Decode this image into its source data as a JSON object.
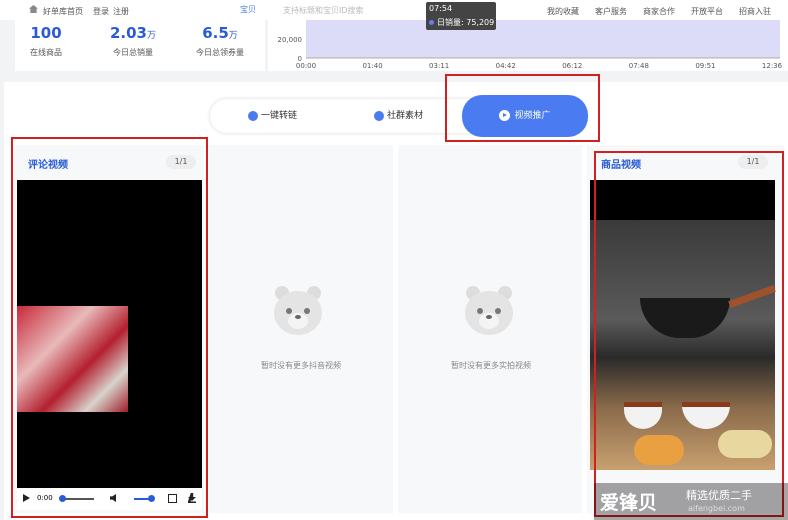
{
  "nav": {
    "home": "好单库首页",
    "login": "登录",
    "register": "注册",
    "search_tab": "宝贝",
    "search_placeholder": "支持标题和宝贝ID搜索",
    "favorites": "我的收藏",
    "service": "客户服务",
    "merchant": "商家合作",
    "open": "开放平台",
    "join": "招商入驻"
  },
  "stats": [
    {
      "value": "100",
      "unit": "",
      "label": "在线商品"
    },
    {
      "value": "2.03",
      "unit": "万",
      "label": "今日总销量"
    },
    {
      "value": "6.5",
      "unit": "万",
      "label": "今日总领券量"
    }
  ],
  "chart_data": {
    "type": "area",
    "x": [
      "00:00",
      "01:40",
      "03:11",
      "04:42",
      "06:12",
      "07:48",
      "09:51",
      "12:36"
    ],
    "yticks": [
      "20,000",
      "0"
    ],
    "tooltip_time": "07:54",
    "tooltip_label": "日销量: 75,209",
    "colors": {
      "fill": "#dcdcf8",
      "line": "#7b7bf0"
    }
  },
  "tabs": {
    "link": "一键转链",
    "material": "社群素材",
    "video": "视频推广"
  },
  "columns": {
    "review_title": "评论视频",
    "review_pager": "1/1",
    "review_time": "0:00",
    "empty1": "暂时没有更多抖音视频",
    "empty2": "暂时没有更多实拍视频",
    "product_title": "商品视频",
    "product_pager": "1/1"
  },
  "watermark": {
    "brand": "爱锋贝",
    "slogan": "精选优质二手",
    "url": "aifengbei.com"
  }
}
